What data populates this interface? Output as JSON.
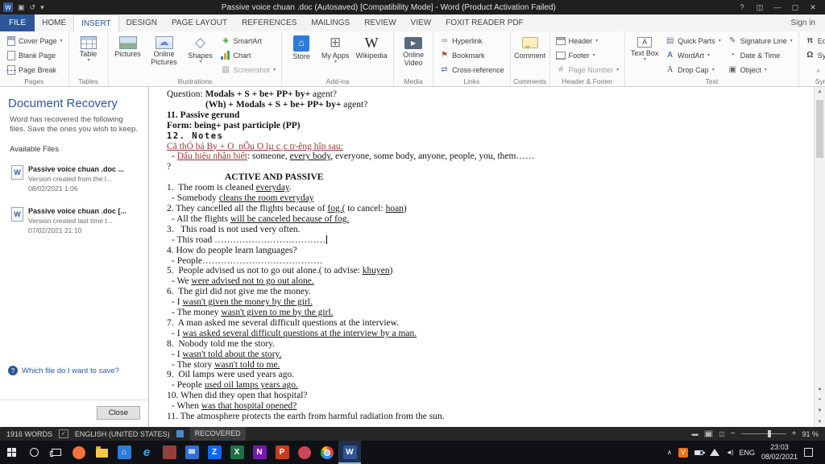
{
  "title_bar": {
    "title": "Passive voice chuan .doc (Autosaved) [Compatibility Mode] - Word (Product Activation Failed)"
  },
  "ribbon": {
    "tabs": [
      "FILE",
      "HOME",
      "INSERT",
      "DESIGN",
      "PAGE LAYOUT",
      "REFERENCES",
      "MAILINGS",
      "REVIEW",
      "VIEW",
      "FOXIT READER PDF"
    ],
    "active_tab": "INSERT",
    "sign_in": "Sign in",
    "pages": {
      "label": "Pages",
      "cover_page": "Cover Page",
      "blank_page": "Blank Page",
      "page_break": "Page Break"
    },
    "tables": {
      "label": "Tables",
      "table": "Table"
    },
    "illustrations": {
      "label": "Illustrations",
      "pictures": "Pictures",
      "online_pictures": "Online Pictures",
      "shapes": "Shapes",
      "smartart": "SmartArt",
      "chart": "Chart",
      "screenshot": "Screenshot"
    },
    "addins": {
      "label": "Add-ins",
      "store": "Store",
      "my_apps": "My Apps",
      "wikipedia": "Wikipedia"
    },
    "media": {
      "label": "Media",
      "online_video": "Online Video"
    },
    "links": {
      "label": "Links",
      "hyperlink": "Hyperlink",
      "bookmark": "Bookmark",
      "cross_reference": "Cross-reference"
    },
    "comments": {
      "label": "Comments",
      "comment": "Comment"
    },
    "header_footer": {
      "label": "Header & Footer",
      "header": "Header",
      "footer": "Footer",
      "page_number": "Page Number"
    },
    "text": {
      "label": "Text",
      "text_box": "Text Box",
      "quick_parts": "Quick Parts",
      "wordart": "WordArt",
      "drop_cap": "Drop Cap",
      "signature_line": "Signature Line",
      "date_time": "Date & Time",
      "object": "Object"
    },
    "symbols": {
      "label": "Symbols",
      "equation": "Equation",
      "symbol": "Symbol"
    }
  },
  "recovery": {
    "title": "Document Recovery",
    "description": "Word has recovered the following files. Save the ones you wish to keep.",
    "available_label": "Available Files",
    "files": [
      {
        "name": "Passive voice chuan .doc ...",
        "desc": "Version created from the l...",
        "date": "08/02/2021 1:06"
      },
      {
        "name": "Passive voice chuan .doc [...",
        "desc": "Version created last time t...",
        "date": "07/02/2021 21:10"
      }
    ],
    "help_link": "Which file do I want to save?",
    "close_label": "Close"
  },
  "document": {
    "lines": [
      {
        "ind": 0,
        "seg": [
          [
            "Question: ",
            ""
          ],
          [
            "Modals + S + be+ PP+ by+",
            "b"
          ],
          [
            " agent?",
            ""
          ]
        ]
      },
      {
        "ind": 48,
        "seg": [
          [
            "(Wh) + Modals + S + be+ PP+ by+",
            "b"
          ],
          [
            " agent?",
            ""
          ]
        ]
      },
      {
        "ind": 0,
        "seg": [
          [
            "11. Passive gerund",
            "b"
          ]
        ]
      },
      {
        "ind": 0,
        "seg": [
          [
            "Form: being+ past participle (PP)",
            "b"
          ]
        ]
      },
      {
        "ind": 0,
        "seg": [
          [
            "12. Notes",
            "bm"
          ]
        ]
      },
      {
        "ind": 0,
        "seg": [
          [
            "Cã thÓ bá By + O  nÕu O lµ c¸c tr-êng hîp sau:",
            "ru"
          ]
        ]
      },
      {
        "ind": 6,
        "seg": [
          [
            "- ",
            ""
          ],
          [
            "Dấu hiệu nhận biết",
            "ru"
          ],
          [
            ": someone, ",
            ""
          ],
          [
            "every body",
            "u"
          ],
          [
            ", everyone, some body, anyone, people, you, them……",
            ""
          ]
        ]
      },
      {
        "ind": 0,
        "seg": [
          [
            "?",
            ""
          ]
        ]
      },
      {
        "ind": 72,
        "seg": [
          [
            "ACTIVE AND PASSIVE",
            "b"
          ]
        ]
      },
      {
        "ind": 0,
        "seg": [
          [
            "1.  The room is cleaned ",
            ""
          ],
          [
            "everyday",
            "u"
          ],
          [
            ".",
            ""
          ]
        ]
      },
      {
        "ind": 6,
        "seg": [
          [
            "- Somebody ",
            ""
          ],
          [
            "cleans the room everyday",
            "u"
          ]
        ]
      },
      {
        "ind": 0,
        "seg": [
          [
            "2. They cancelled all the flights because of ",
            ""
          ],
          [
            "fog.(",
            "u"
          ],
          [
            " to cancel: ",
            ""
          ],
          [
            "hoan",
            "u"
          ],
          [
            ")",
            ""
          ]
        ]
      },
      {
        "ind": 6,
        "seg": [
          [
            "- All the flights ",
            ""
          ],
          [
            "will be canceled because of fog.",
            "u"
          ]
        ]
      },
      {
        "ind": 0,
        "seg": [
          [
            "3.   This road is not used very often.",
            ""
          ]
        ]
      },
      {
        "ind": 6,
        "cursor": true,
        "seg": [
          [
            "- This road ………………………………",
            ""
          ]
        ]
      },
      {
        "ind": 0,
        "seg": [
          [
            "4. How do people learn languages?",
            ""
          ]
        ]
      },
      {
        "ind": 6,
        "seg": [
          [
            "- People…………………………………",
            ""
          ]
        ]
      },
      {
        "ind": 0,
        "seg": [
          [
            "5.  People advised us not to go out alone.( to advise: ",
            ""
          ],
          [
            "khuyen",
            "u"
          ],
          [
            ")",
            ""
          ]
        ]
      },
      {
        "ind": 6,
        "seg": [
          [
            "- We ",
            ""
          ],
          [
            "were advised not to go out alone.",
            "u"
          ]
        ]
      },
      {
        "ind": 0,
        "seg": [
          [
            "6.  The girl did not give me the money.",
            ""
          ]
        ]
      },
      {
        "ind": 6,
        "seg": [
          [
            "- I ",
            ""
          ],
          [
            "wasn't given the money by the girl.",
            "u"
          ]
        ]
      },
      {
        "ind": 6,
        "seg": [
          [
            "- The money ",
            ""
          ],
          [
            "wasn't given to me by the girl.",
            "u"
          ]
        ]
      },
      {
        "ind": 0,
        "seg": [
          [
            "7.  A man asked me several difficult questions at the interview.",
            ""
          ]
        ]
      },
      {
        "ind": 6,
        "seg": [
          [
            "- I ",
            ""
          ],
          [
            "was asked several difficult questions at the interview by a man.",
            "u"
          ]
        ]
      },
      {
        "ind": 0,
        "seg": [
          [
            "8.  Nobody told me the story.",
            ""
          ]
        ]
      },
      {
        "ind": 6,
        "seg": [
          [
            "- I ",
            ""
          ],
          [
            "wasn't told about the story.",
            "u"
          ]
        ]
      },
      {
        "ind": 6,
        "seg": [
          [
            "- The story ",
            ""
          ],
          [
            "wasn't told to me.",
            "u"
          ]
        ]
      },
      {
        "ind": 0,
        "seg": [
          [
            "9.  Oil lamps were used years ago.",
            ""
          ]
        ]
      },
      {
        "ind": 6,
        "seg": [
          [
            "- People ",
            ""
          ],
          [
            "used oil lamps years ago.",
            "u"
          ]
        ]
      },
      {
        "ind": 0,
        "seg": [
          [
            "10. When did they open that hospital?",
            ""
          ]
        ]
      },
      {
        "ind": 6,
        "seg": [
          [
            "- When ",
            ""
          ],
          [
            "was that hospital opened?",
            "u"
          ]
        ]
      },
      {
        "ind": 0,
        "seg": [
          [
            "11. The atmosphere protects the earth from harmful radiation from the sun.",
            ""
          ]
        ]
      }
    ]
  },
  "status_bar": {
    "word_count": "1916 WORDS",
    "language": "ENGLISH (UNITED STATES)",
    "recovered_label": "RECOVERED",
    "zoom_percent": "91 %"
  },
  "taskbar": {
    "apps": [
      {
        "name": "start-button",
        "kind": "win"
      },
      {
        "name": "search-button",
        "kind": "search"
      },
      {
        "name": "task-view-button",
        "kind": "taskview"
      },
      {
        "name": "firefox-icon",
        "kind": "circle",
        "color": "#ff7139"
      },
      {
        "name": "file-explorer-icon",
        "kind": "folder",
        "color": "#f8c64b"
      },
      {
        "name": "store-icon",
        "kind": "square",
        "color": "#2f7cd6",
        "glyph": "⌂"
      },
      {
        "name": "edge-icon",
        "kind": "glyph",
        "glyph": "e",
        "color": "#4aa8e8"
      },
      {
        "name": "photos-icon",
        "kind": "square",
        "color": "#93403a",
        "glyph": ""
      },
      {
        "name": "mail-icon",
        "kind": "square",
        "color": "#2f6fd0",
        "glyph": "✉"
      },
      {
        "name": "zalo-icon",
        "kind": "square",
        "color": "#0c68f0",
        "glyph": "Z"
      },
      {
        "name": "excel-icon",
        "kind": "square",
        "color": "#1e7145",
        "glyph": "X"
      },
      {
        "name": "onenote-icon",
        "kind": "square",
        "color": "#7719aa",
        "glyph": "N"
      },
      {
        "name": "powerpoint-icon",
        "kind": "square",
        "color": "#c43e1c",
        "glyph": "P"
      },
      {
        "name": "camera-icon",
        "kind": "circle",
        "color": "#d04458",
        "glyph": ""
      },
      {
        "name": "chrome-icon",
        "kind": "chrome"
      },
      {
        "name": "word-taskbar-icon",
        "kind": "square",
        "color": "#2b579a",
        "glyph": "W",
        "active": true
      }
    ],
    "tray": {
      "input_lang": "ENG",
      "time": "23:03",
      "date": "08/02/2021"
    }
  },
  "colors": {
    "accent": "#2b579a",
    "title_bar_bg": "#1f1f1f",
    "status_bar_bg": "#262626",
    "taskbar_bg": "#0f1117",
    "document_red": "#953735",
    "active_app_underline": "#76b9ed"
  }
}
